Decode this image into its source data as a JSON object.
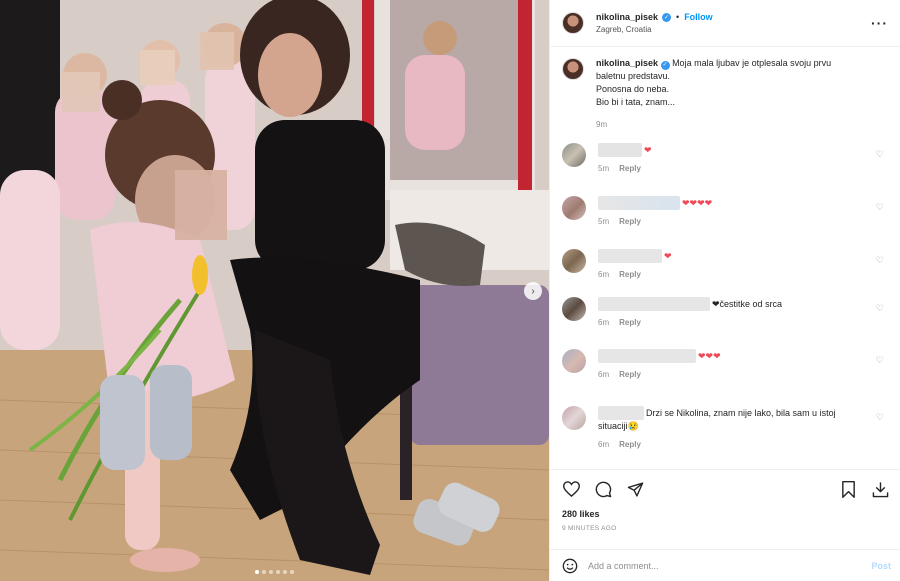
{
  "header": {
    "username": "nikolina_pisek",
    "separator": "•",
    "follow_label": "Follow",
    "location": "Zagreb, Croatia",
    "more_icon": "more-horizontal-icon"
  },
  "caption": {
    "username": "nikolina_pisek",
    "lines": [
      "Moja mala ljubav je otplesala svoju prvu",
      "baletnu predstavu.",
      "Ponosna do neba.",
      "Bio bi i tata, znam..."
    ],
    "time": "9m"
  },
  "comments": [
    {
      "text": "❤",
      "time": "5m",
      "reply": "Reply"
    },
    {
      "text": "❤❤❤❤",
      "time": "5m",
      "reply": "Reply"
    },
    {
      "text": "❤",
      "time": "6m",
      "reply": "Reply"
    },
    {
      "text": "❤čestitke od srca",
      "time": "6m",
      "reply": "Reply"
    },
    {
      "text": "❤❤❤",
      "time": "6m",
      "reply": "Reply"
    },
    {
      "text": "Drzi se Nikolina, znam nije lako, bila sam u istoj",
      "text2": "situaciji😢",
      "time": "6m",
      "reply": "Reply"
    }
  ],
  "actions": {
    "likes": "280 likes",
    "ago": "9 MINUTES AGO"
  },
  "add_comment": {
    "placeholder": "Add a comment...",
    "post_label": "Post"
  },
  "colors": {
    "accent": "#0095f6",
    "heart_red": "#ed4956",
    "muted": "#8e8e8e"
  },
  "carousel": {
    "dot_count": 6,
    "active_index": 0
  }
}
